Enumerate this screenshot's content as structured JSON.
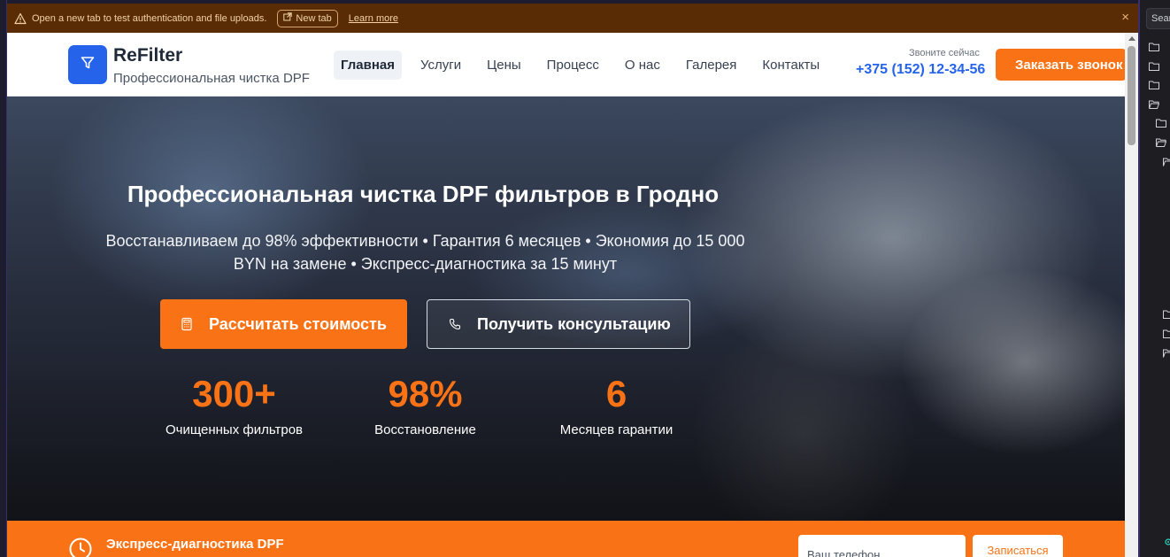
{
  "notice": {
    "message": "Open a new tab to test authentication and file uploads.",
    "new_tab_label": "New tab",
    "learn_more_label": "Learn more",
    "close_glyph": "×"
  },
  "header": {
    "brand": "ReFilter",
    "brand_subtitle": "Профессиональная чистка DPF",
    "nav": [
      {
        "label": "Главная",
        "active": true
      },
      {
        "label": "Услуги",
        "active": false
      },
      {
        "label": "Цены",
        "active": false
      },
      {
        "label": "Процесс",
        "active": false
      },
      {
        "label": "О нас",
        "active": false
      },
      {
        "label": "Галерея",
        "active": false
      },
      {
        "label": "Контакты",
        "active": false
      }
    ],
    "call_label": "Звоните сейчас",
    "phone": "+375 (152) 12-34-56",
    "order_button": "Заказать звонок"
  },
  "hero": {
    "title": "Профессиональная чистка DPF фильтров в Гродно",
    "subtitle": "Восстанавливаем до 98% эффективности • Гарантия 6 месяцев • Экономия до 15 000 BYN на замене • Экспресс-диагностика за 15 минут",
    "primary_button": "Рассчитать стоимость",
    "secondary_button": "Получить консультацию",
    "stats": [
      {
        "value": "300+",
        "label": "Очищенных фильтров"
      },
      {
        "value": "98%",
        "label": "Восстановление"
      },
      {
        "value": "6",
        "label": "Месяцев гарантии"
      }
    ]
  },
  "express": {
    "title": "Экспресс-диагностика DPF",
    "phone_placeholder": "Ваш телефон",
    "signup_button": "Записаться"
  },
  "side_panel": {
    "search_placeholder": "Sear"
  },
  "colors": {
    "accent_orange": "#f97316",
    "brand_blue": "#2563eb",
    "notice_bg": "#5a2c06"
  },
  "icons": {
    "notice": "warning-icon",
    "new_tab": "external-link-icon",
    "logo": "funnel-filter-icon",
    "primary_button": "calculator-icon",
    "secondary_button": "phone-icon",
    "express": "clock-icon"
  }
}
